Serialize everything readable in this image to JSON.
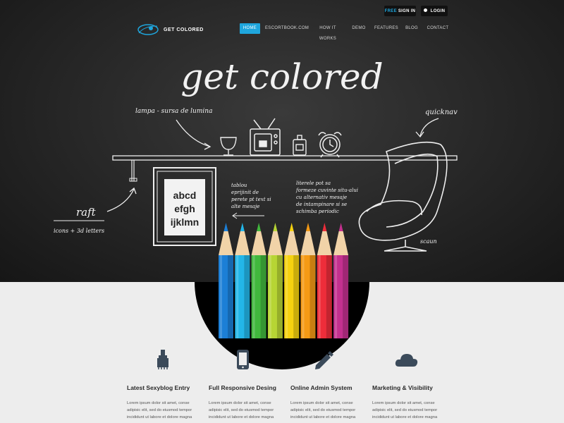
{
  "header": {
    "logo_text": "GET COLORED",
    "signin_free": "FREE",
    "signin_label": "SIGN IN",
    "login_label": "LOGIN"
  },
  "nav": {
    "items": [
      "HOME",
      "ESCORTBOOK.COM",
      "HOW IT WORKS",
      "DEMO",
      "FEATURES",
      "BLOG",
      "CONTACT"
    ],
    "active": "HOME"
  },
  "hero": {
    "title": "get colored",
    "note_lamp": "lampa - sursa de lumina",
    "note_nav": "quicknav",
    "note_shelf_big": "raft",
    "note_shelf_small": "icons + 3d letters",
    "poster_lines": [
      "abcd",
      "efgh",
      "ijklmn"
    ],
    "note_tablou": [
      "tablou",
      "eprijinit de",
      "perete pt text si",
      "alte mesaje"
    ],
    "note_litere": [
      "literele pot sa",
      "formeze cuvinte situ-alui",
      "cu alternativ mesaje",
      "de intampinare si se",
      "schimba periodic"
    ],
    "note_chair": "scaun"
  },
  "pencil_colors": [
    "#1c7fd6",
    "#23b6e8",
    "#41b83d",
    "#b7d534",
    "#f6d20f",
    "#f59a15",
    "#ee2d3a",
    "#c4308f"
  ],
  "features": [
    {
      "icon": "brush-icon",
      "title": "Latest Sexyblog Entry",
      "text": "Lorem ipsum dolor sit amet, conse adipisic elit, sed do eiusmod tempor incididunt ut labore et dolore magna"
    },
    {
      "icon": "phone-icon",
      "title": "Full Responsive Desing",
      "text": "Lorem ipsum dolor sit amet, conse adipisic elit, sed do eiusmod tempor incididunt ut labore et dolore magna"
    },
    {
      "icon": "pencil-icon",
      "title": "Online Admin System",
      "text": "Lorem ipsum dolor sit amet, conse adipisic elit, sed do eiusmod tempor incididunt ut labore et dolore magna"
    },
    {
      "icon": "cloud-icon",
      "title": "Marketing & Visibility",
      "text": "Lorem ipsum dolor sit amet, conse adipisic elit, sed do eiusmod tempor incididunt ut labore et dolore magna"
    }
  ],
  "colors": {
    "accent": "#1fa6dd",
    "chalkboard": "#262626",
    "page_bg": "#ededed"
  }
}
